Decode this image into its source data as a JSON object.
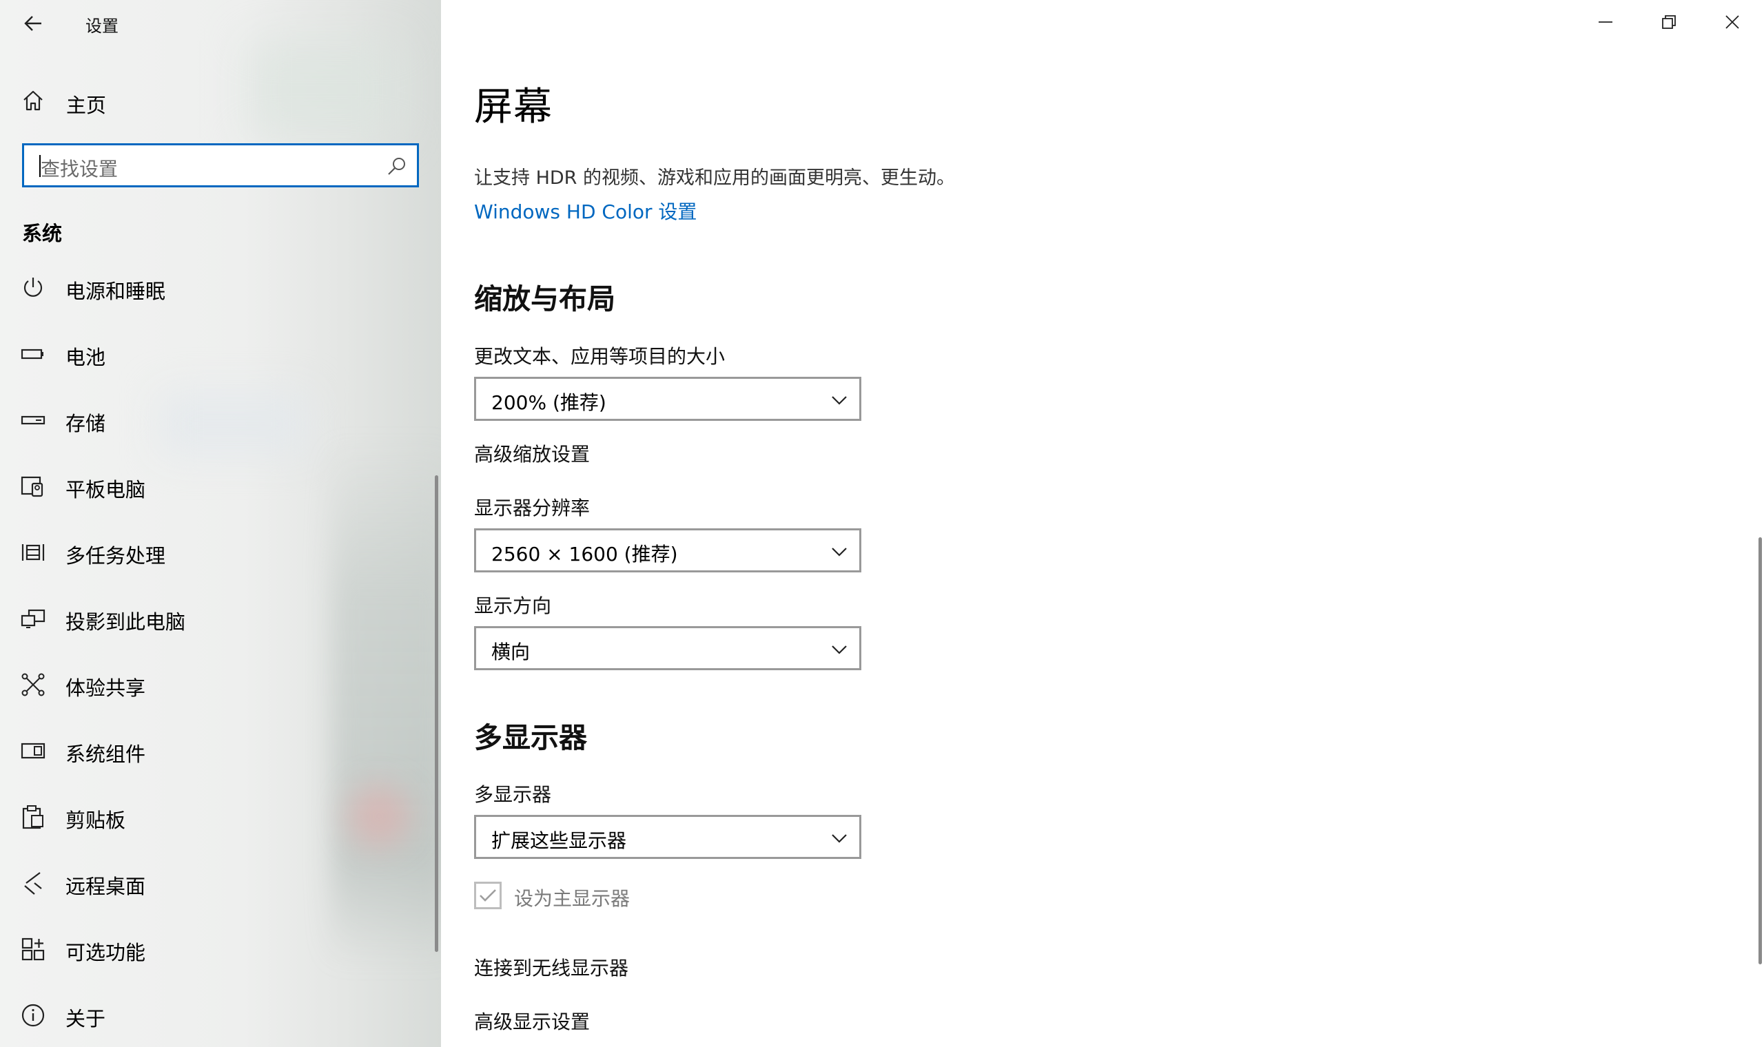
{
  "window": {
    "title": "设置"
  },
  "sidebar": {
    "home_label": "主页",
    "search": {
      "placeholder": "查找设置"
    },
    "section_title": "系统",
    "items": [
      {
        "label": "电源和睡眠",
        "icon": "power-icon"
      },
      {
        "label": "电池",
        "icon": "battery-icon"
      },
      {
        "label": "存储",
        "icon": "storage-icon"
      },
      {
        "label": "平板电脑",
        "icon": "tablet-icon"
      },
      {
        "label": "多任务处理",
        "icon": "multitasking-icon"
      },
      {
        "label": "投影到此电脑",
        "icon": "project-icon"
      },
      {
        "label": "体验共享",
        "icon": "shared-experiences-icon"
      },
      {
        "label": "系统组件",
        "icon": "system-components-icon"
      },
      {
        "label": "剪贴板",
        "icon": "clipboard-icon"
      },
      {
        "label": "远程桌面",
        "icon": "remote-desktop-icon"
      },
      {
        "label": "可选功能",
        "icon": "optional-features-icon"
      },
      {
        "label": "关于",
        "icon": "info-icon"
      }
    ]
  },
  "main": {
    "title": "屏幕",
    "hdr_description": "让支持 HDR 的视频、游戏和应用的画面更明亮、更生动。",
    "hdr_link": "Windows HD Color 设置",
    "scale_section": {
      "heading": "缩放与布局",
      "scale_label": "更改文本、应用等项目的大小",
      "scale_value": "200% (推荐)",
      "advanced_scaling_link": "高级缩放设置",
      "resolution_label": "显示器分辨率",
      "resolution_value": "2560 × 1600 (推荐)",
      "orientation_label": "显示方向",
      "orientation_value": "横向"
    },
    "multi_display": {
      "heading": "多显示器",
      "label": "多显示器",
      "value": "扩展这些显示器",
      "primary_checkbox_label": "设为主显示器",
      "primary_checked": true,
      "wireless_link": "连接到无线显示器",
      "advanced_display_link": "高级显示设置"
    }
  },
  "colors": {
    "accent": "#0067c0",
    "sidebar_bg": "#eeefee"
  }
}
